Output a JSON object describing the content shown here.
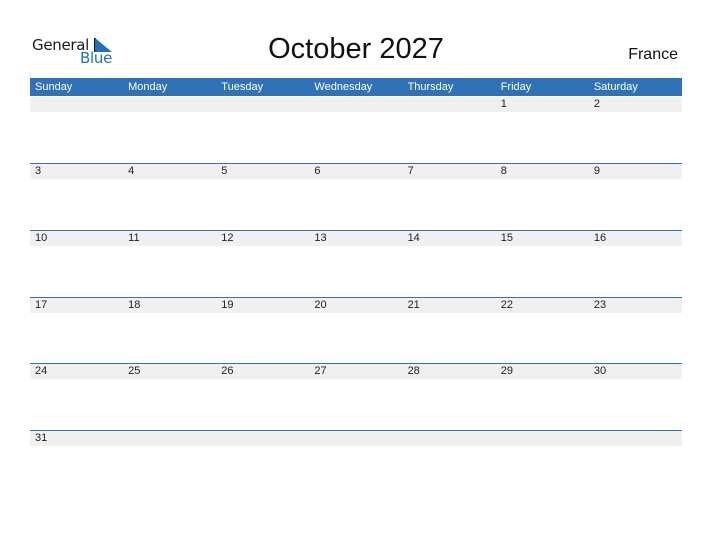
{
  "logo": {
    "word1": "General",
    "word2": "Blue"
  },
  "title": "October 2027",
  "country": "France",
  "weekdays": [
    "Sunday",
    "Monday",
    "Tuesday",
    "Wednesday",
    "Thursday",
    "Friday",
    "Saturday"
  ],
  "weeks": [
    [
      "",
      "",
      "",
      "",
      "",
      "1",
      "2"
    ],
    [
      "3",
      "4",
      "5",
      "6",
      "7",
      "8",
      "9"
    ],
    [
      "10",
      "11",
      "12",
      "13",
      "14",
      "15",
      "16"
    ],
    [
      "17",
      "18",
      "19",
      "20",
      "21",
      "22",
      "23"
    ],
    [
      "24",
      "25",
      "26",
      "27",
      "28",
      "29",
      "30"
    ],
    [
      "31",
      "",
      "",
      "",
      "",
      "",
      ""
    ]
  ]
}
